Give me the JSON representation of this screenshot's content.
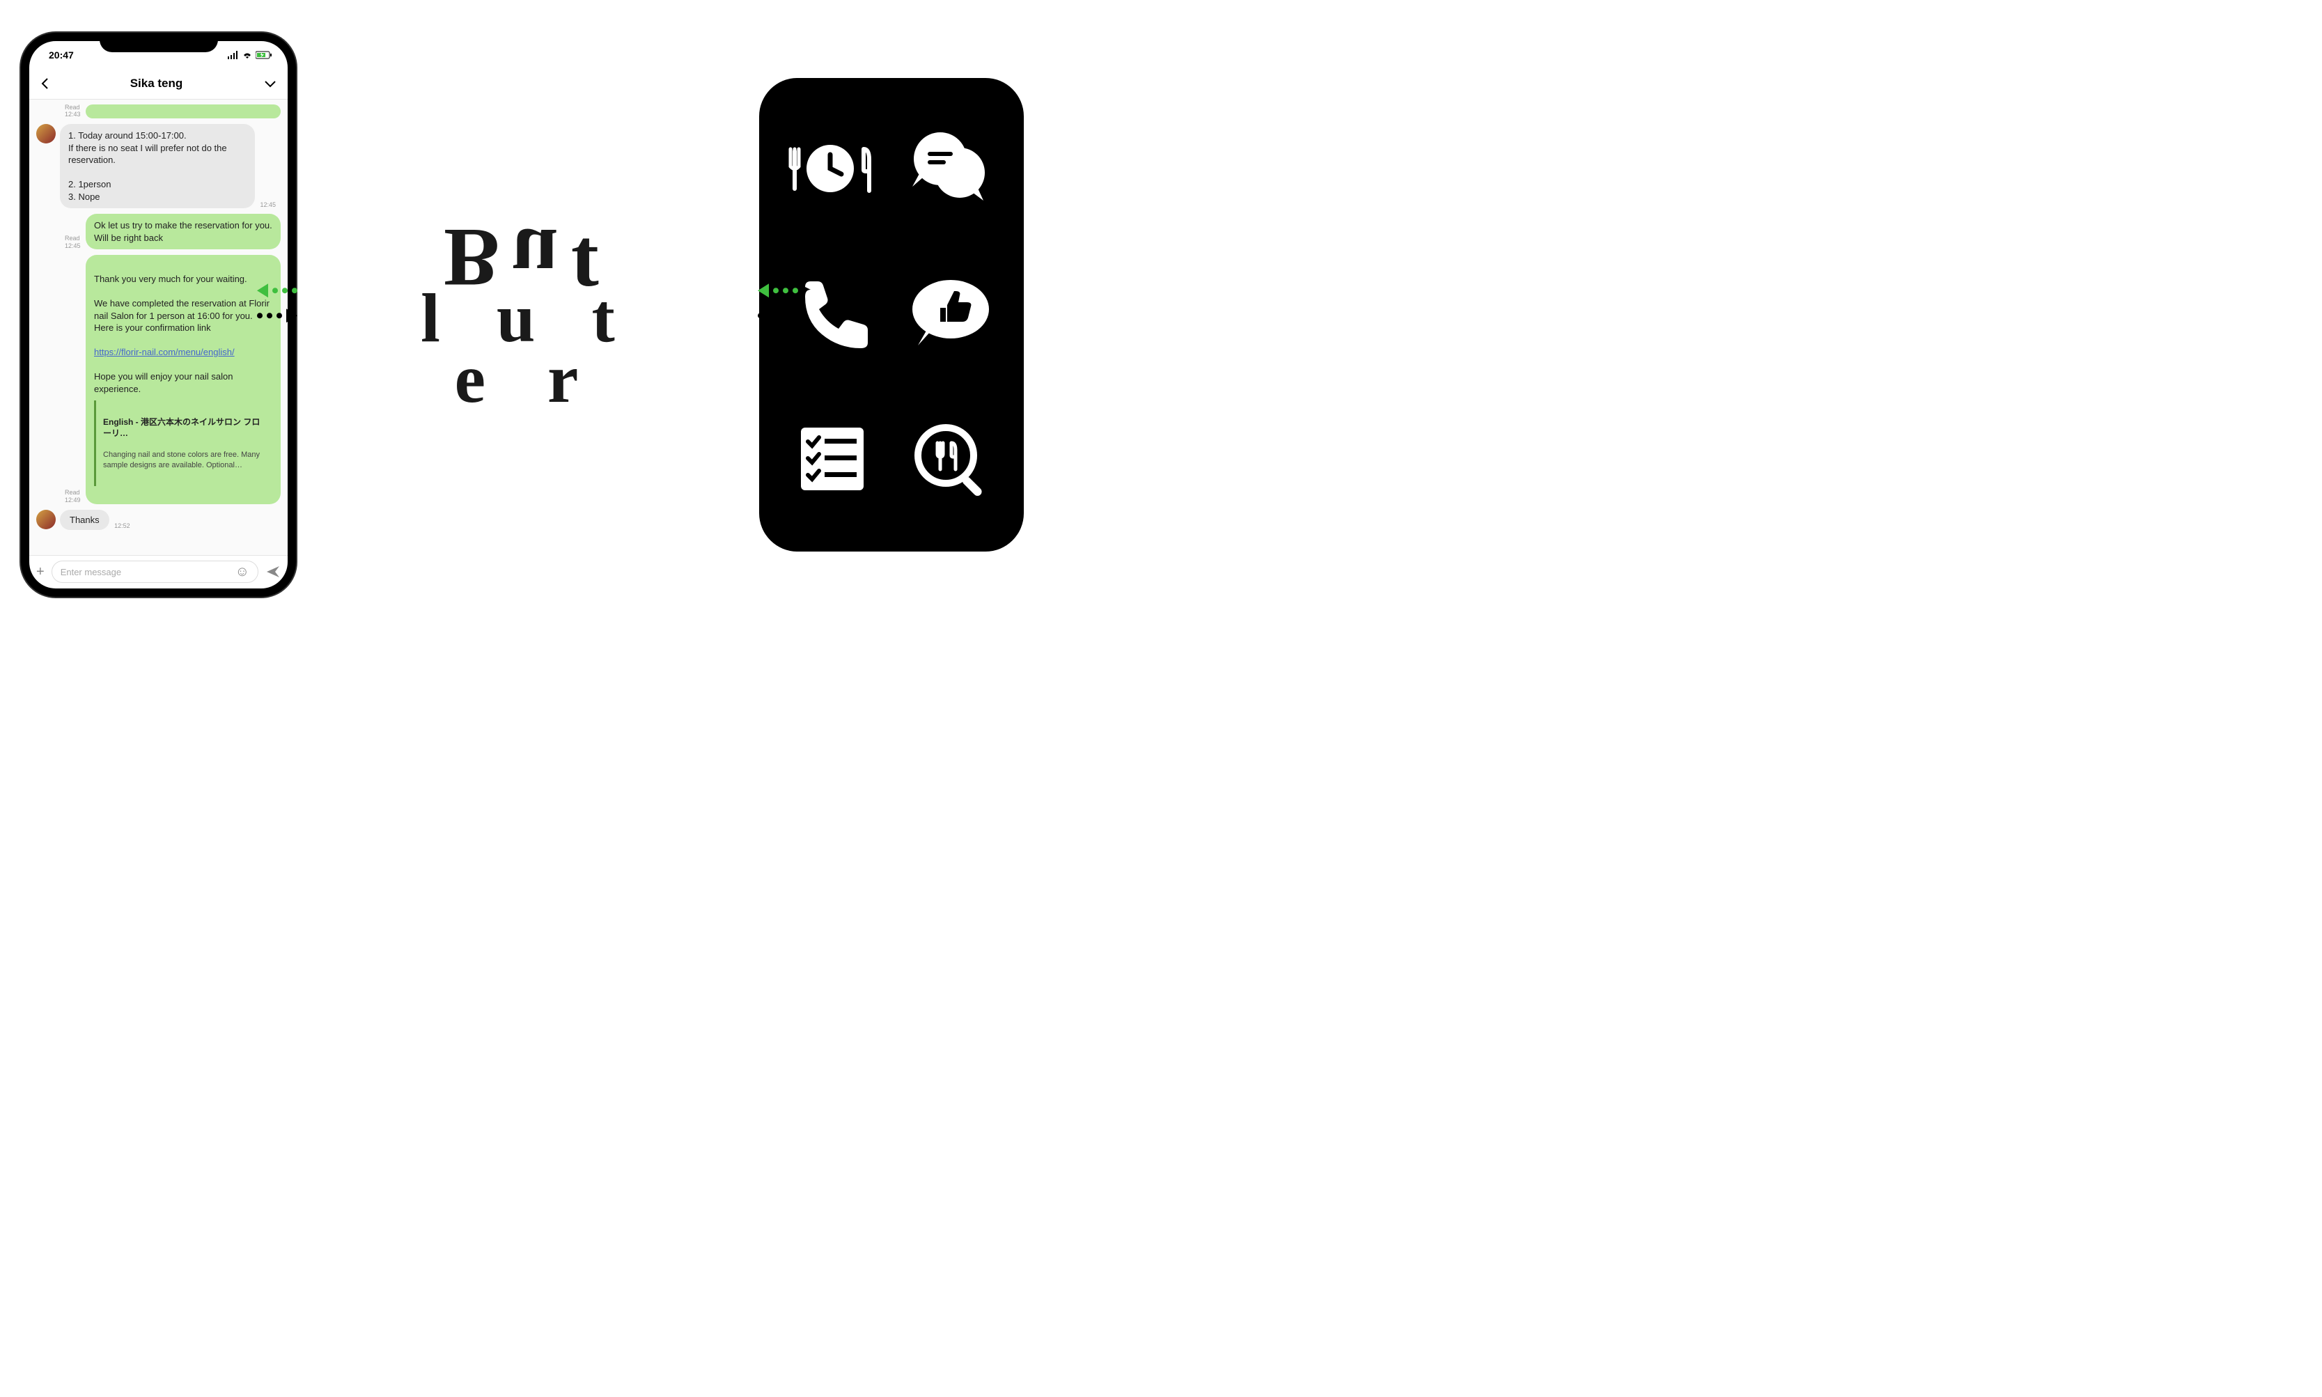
{
  "status": {
    "time": "20:47"
  },
  "chat": {
    "title": "Sika teng",
    "input_placeholder": "Enter message",
    "m1_meta": "Read\n12:43",
    "m2_text": "1. Today around 15:00-17:00.\nIf there is no seat I will prefer not do the reservation.\n\n2. 1person\n3. Nope",
    "m2_time": "12:45",
    "m3_meta": "Read\n12:45",
    "m3_text": "Ok let us try to make the reservation for you. Will be right back",
    "m4_meta": "Read\n12:49",
    "m4_text_a": "Thank you very much for your waiting.\n\nWe have completed the reservation at Florir nail Salon for 1 person at 16:00 for you.\nHere is your confirmation link",
    "m4_link": "https://florir-nail.com/menu/english/",
    "m4_text_b": "\nHope you will enjoy your nail salon experience.",
    "m4_preview_title": "English - 港区六本木のネイルサロン フローリ…",
    "m4_preview_body": "Changing nail and stone colors are free. Many sample designs are available. Optional…",
    "m5_text": "Thanks",
    "m5_time": "12:52"
  },
  "logo": {
    "r1": "But",
    "r2": "l  u  t",
    "r3": "e r"
  },
  "icons": {
    "restaurant_time": "restaurant-time-icon",
    "chat": "chat-bubbles-icon",
    "phone": "phone-icon",
    "like": "like-bubble-icon",
    "checklist": "checklist-icon",
    "food_search": "food-search-icon"
  }
}
